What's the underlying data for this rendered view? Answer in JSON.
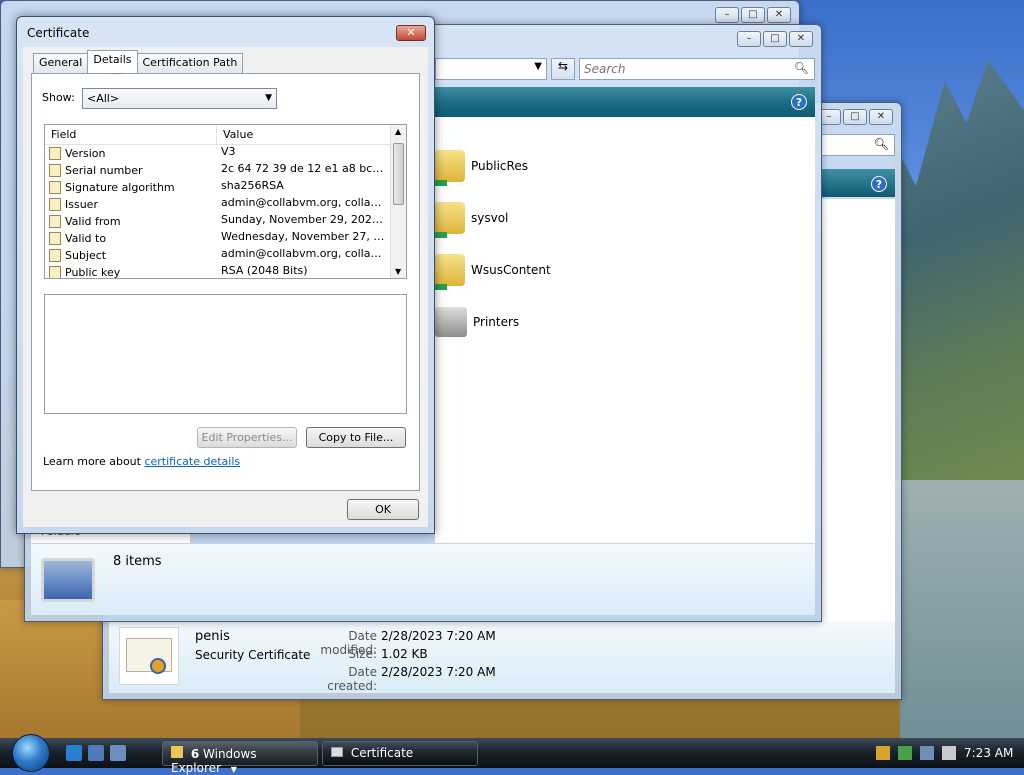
{
  "desktop": {},
  "explorer_mid": {
    "search_placeholder": "Search",
    "items": [
      {
        "label": "PublicRes",
        "icon": "network-folder-icon"
      },
      {
        "label": "sysvol",
        "icon": "network-folder-icon"
      },
      {
        "label": "WsusContent",
        "icon": "network-folder-icon"
      },
      {
        "label": "Printers",
        "icon": "printer-icon"
      }
    ],
    "status_count": "8 items",
    "folders_label": "Folders"
  },
  "explorer_front": {
    "details": {
      "file_name": "penis",
      "file_type": "Security Certificate",
      "rows": [
        {
          "key": "Date modified:",
          "value": "2/28/2023 7:20 AM"
        },
        {
          "key": "Size:",
          "value": "1.02 KB"
        },
        {
          "key": "Date created:",
          "value": "2/28/2023 7:20 AM"
        }
      ]
    }
  },
  "cert_dialog": {
    "title": "Certificate",
    "tabs": [
      "General",
      "Details",
      "Certification Path"
    ],
    "active_tab": "Details",
    "show_label": "Show:",
    "show_value": "<All>",
    "columns": {
      "field": "Field",
      "value": "Value"
    },
    "rows": [
      {
        "field": "Version",
        "value": "V3"
      },
      {
        "field": "Serial number",
        "value": "2c 64 72 39 de 12 e1 a8 bc 22..."
      },
      {
        "field": "Signature algorithm",
        "value": "sha256RSA"
      },
      {
        "field": "Issuer",
        "value": "admin@collabvm.org, collabne..."
      },
      {
        "field": "Valid from",
        "value": "Sunday, November 29, 2020 9..."
      },
      {
        "field": "Valid to",
        "value": "Wednesday, November 27, 20..."
      },
      {
        "field": "Subject",
        "value": "admin@collabvm.org, collabne..."
      },
      {
        "field": "Public key",
        "value": "RSA (2048 Bits)"
      }
    ],
    "edit_properties": "Edit Properties...",
    "copy_to_file": "Copy to File...",
    "learn_prefix": "Learn more about",
    "learn_link": "certificate details",
    "ok": "OK"
  },
  "taskbar": {
    "tasks": [
      {
        "count": "6",
        "label": "Windows Explorer"
      },
      {
        "label": "Certificate"
      }
    ],
    "clock": "7:23 AM"
  }
}
